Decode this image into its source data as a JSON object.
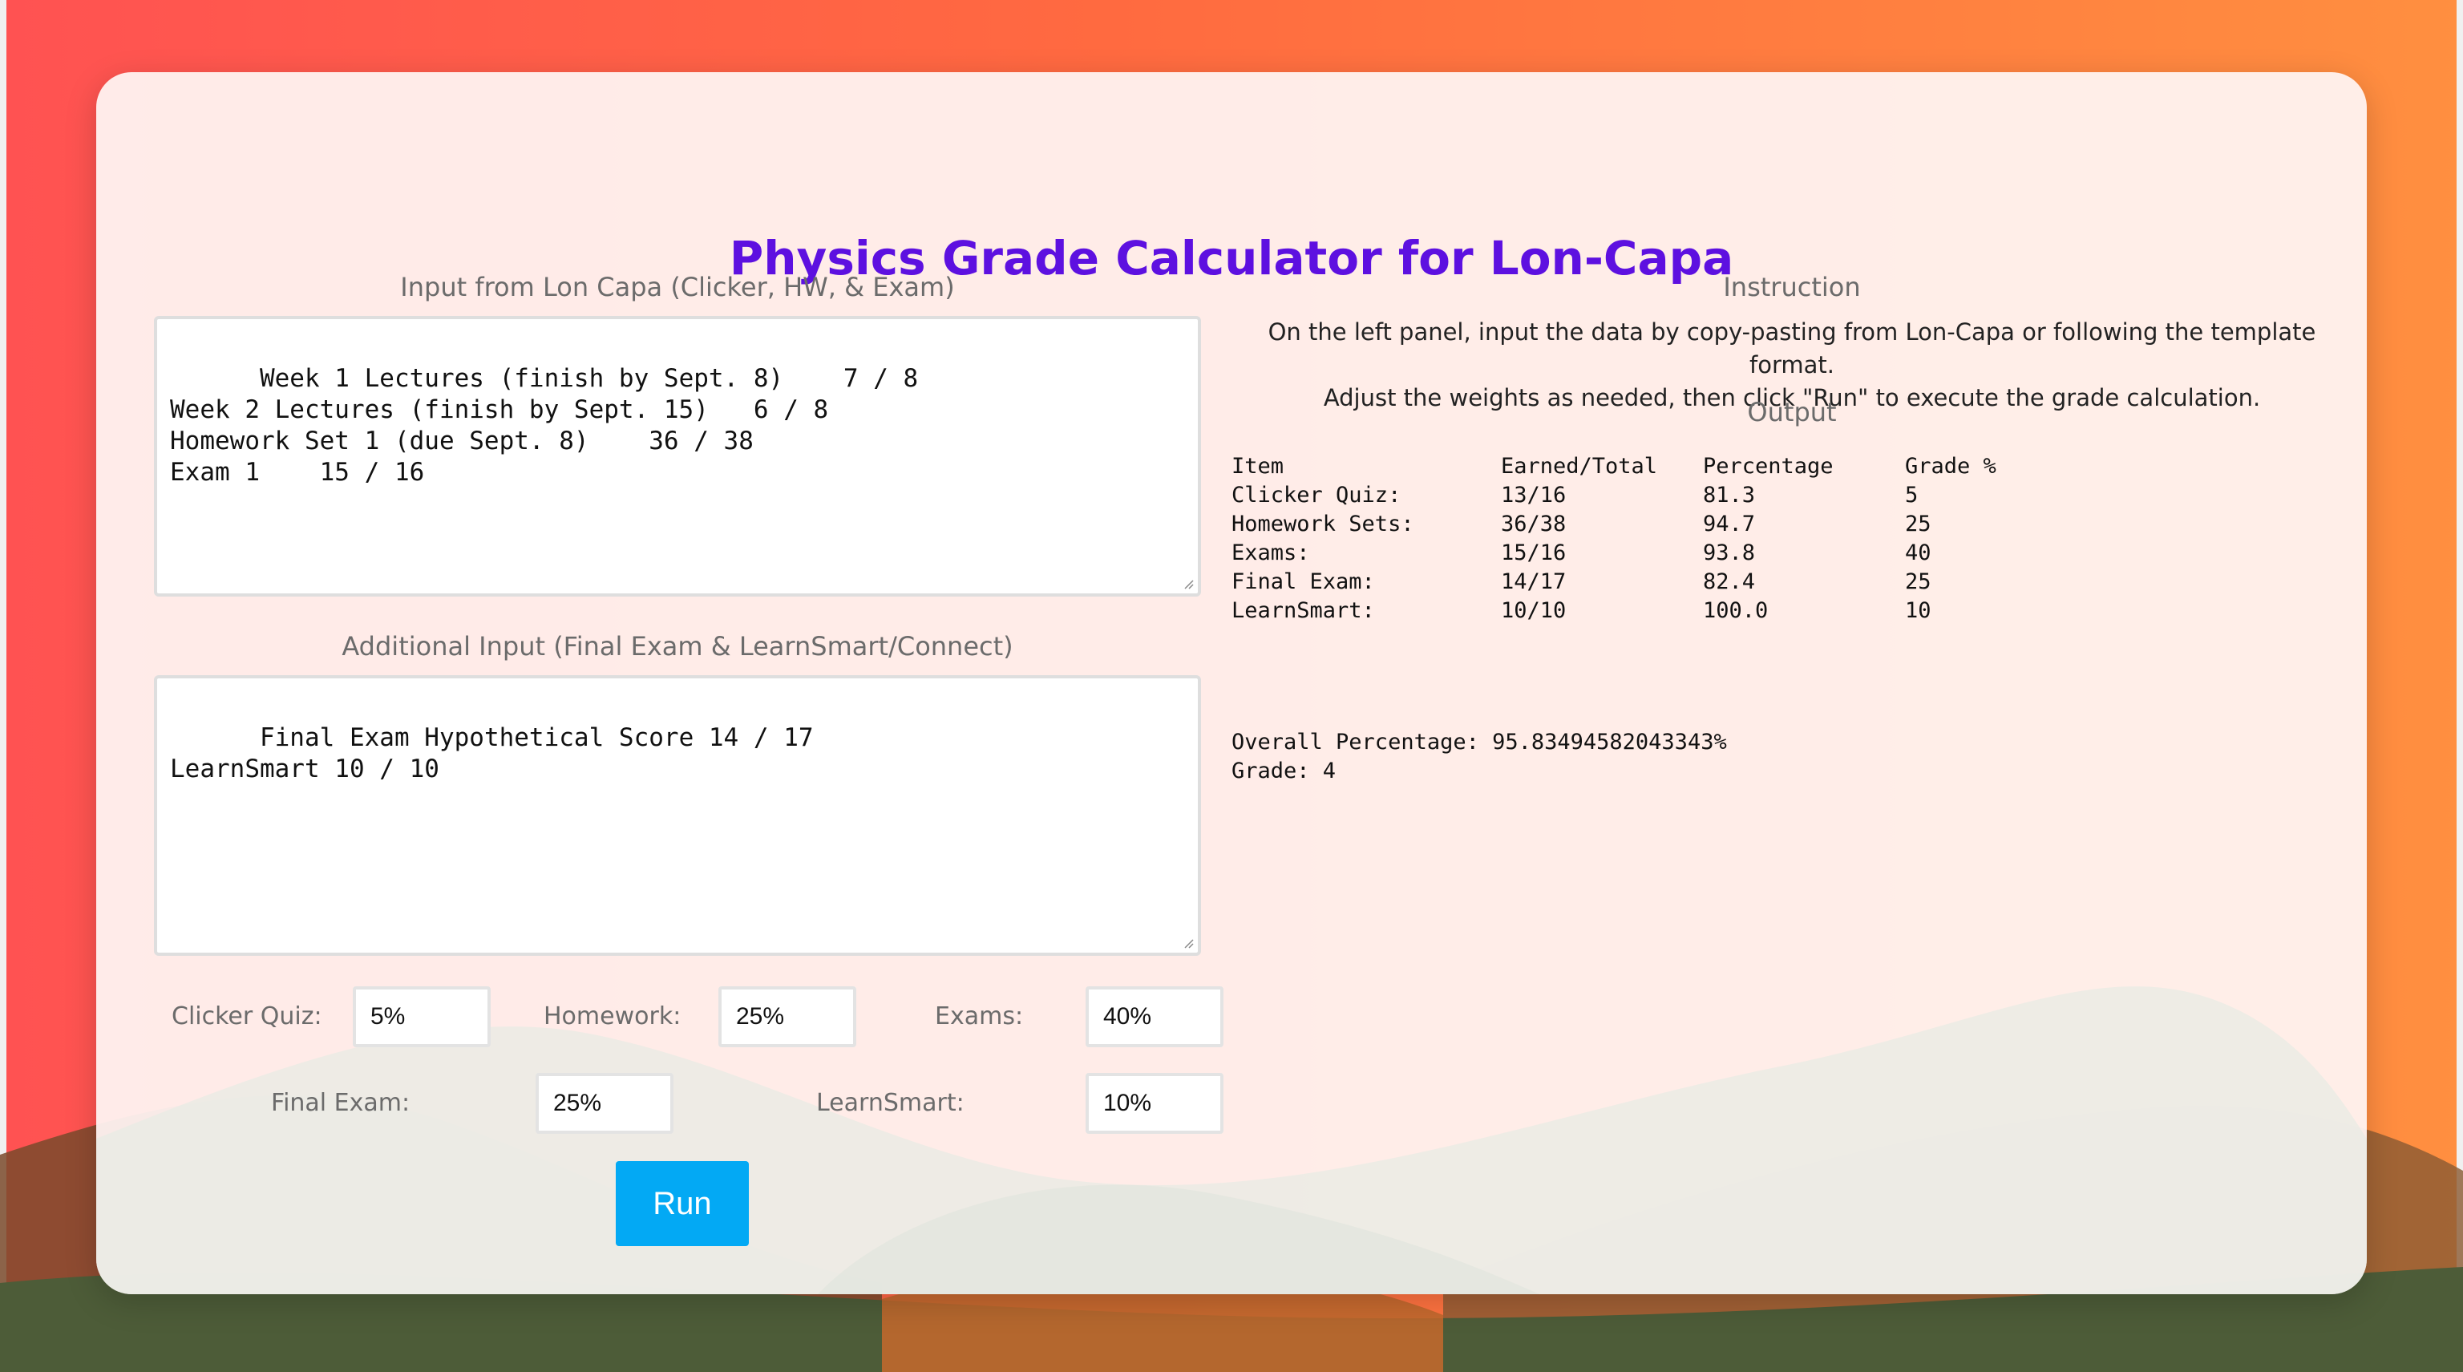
{
  "app": {
    "title": "Physics Grade Calculator for Lon-Capa"
  },
  "input_panel": {
    "label": "Input from Lon Capa (Clicker, HW, & Exam)",
    "value": "Week 1 Lectures (finish by Sept. 8)    7 / 8\nWeek 2 Lectures (finish by Sept. 15)   6 / 8\nHomework Set 1 (due Sept. 8)    36 / 38\nExam 1    15 / 16"
  },
  "additional_panel": {
    "label": "Additional Input (Final Exam & LearnSmart/Connect)",
    "value": "Final Exam Hypothetical Score 14 / 17\nLearnSmart 10 / 10"
  },
  "weights": {
    "clicker_label": "Clicker Quiz:",
    "clicker_value": "5%",
    "homework_label": "Homework:",
    "homework_value": "25%",
    "exams_label": "Exams:",
    "exams_value": "40%",
    "final_label": "Final Exam:",
    "final_value": "25%",
    "learnsmart_label": "LearnSmart:",
    "learnsmart_value": "10%"
  },
  "run_button": {
    "label": "Run"
  },
  "instruction": {
    "heading": "Instruction",
    "line1": "On the left panel, input the data by copy-pasting from Lon-Capa or following the template format.",
    "line2": "Adjust the weights as needed, then click \"Run\" to execute the grade calculation."
  },
  "output": {
    "heading": "Output",
    "columns": [
      "Item",
      "Earned/Total",
      "Percentage",
      "Grade %"
    ],
    "rows": [
      [
        "Clicker Quiz:",
        "13/16",
        "81.3",
        "5"
      ],
      [
        "Homework Sets:",
        "36/38",
        "94.7",
        "25"
      ],
      [
        "Exams:",
        "15/16",
        "93.8",
        "40"
      ],
      [
        "Final Exam:",
        "14/17",
        "82.4",
        "25"
      ],
      [
        "LearnSmart:",
        "10/10",
        "100.0",
        "10"
      ]
    ],
    "overall": "Overall Percentage: 95.83494582043343%",
    "grade": "Grade: 4"
  },
  "colors": {
    "title": "#5d10e0",
    "run_button": "#03a9f4",
    "background_left": "#ff5252",
    "background_right": "#ff8f40"
  }
}
